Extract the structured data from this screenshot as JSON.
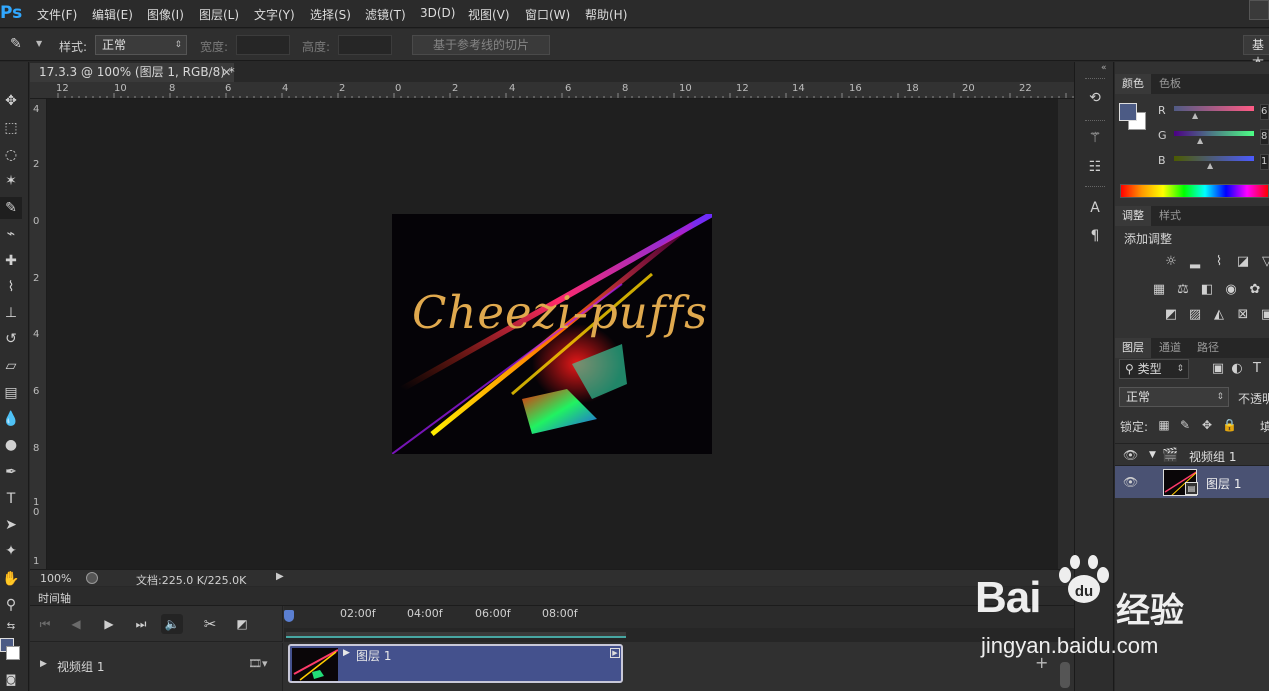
{
  "app": {
    "logo": "Ps"
  },
  "menu": [
    "文件(F)",
    "编辑(E)",
    "图像(I)",
    "图层(L)",
    "文字(Y)",
    "选择(S)",
    "滤镜(T)",
    "3D(D)",
    "视图(V)",
    "窗口(W)",
    "帮助(H)"
  ],
  "options": {
    "style_label": "样式:",
    "style_value": "正常",
    "width_label": "宽度:",
    "height_label": "高度:",
    "guide_slice_button": "基于参考线的切片",
    "workspace": "基本"
  },
  "document": {
    "tab_title": "17.3.3 @ 100% (图层 1, RGB/8) *",
    "artwork_text": "Cheezi-puffs"
  },
  "ruler": {
    "top": [
      "12",
      "10",
      "8",
      "6",
      "4",
      "2",
      "0",
      "2",
      "4",
      "6",
      "8",
      "10",
      "12",
      "14",
      "16",
      "18",
      "20",
      "22"
    ],
    "left": [
      "4",
      "2",
      "0",
      "2",
      "4",
      "6",
      "8",
      "1\n0",
      "1"
    ]
  },
  "status": {
    "zoom": "100%",
    "doc": "文档:225.0 K/225.0K"
  },
  "timeline": {
    "title": "时间轴",
    "times": [
      "02:00f",
      "04:00f",
      "06:00f",
      "08:00f"
    ],
    "track_label": "视频组 1",
    "clip_label": "图层 1"
  },
  "panels": {
    "color_tabs": [
      "颜色",
      "色板"
    ],
    "rgb": [
      {
        "label": "R",
        "value": "6"
      },
      {
        "label": "G",
        "value": "8"
      },
      {
        "label": "B",
        "value": "1"
      }
    ],
    "adjust_tabs": [
      "调整",
      "样式"
    ],
    "adjust_title": "添加调整",
    "layers_tabs": [
      "图层",
      "通道",
      "路径"
    ],
    "filter_label": "类型",
    "blend_mode": "正常",
    "opacity_label": "不透明",
    "lock_label": "锁定:",
    "fill_label": "填",
    "group_name": "视频组 1",
    "layer_name": "图层 1"
  },
  "colors": {
    "foreground": "#4c5b85",
    "background": "#ffffff",
    "accent": "#31a8ff",
    "clip": "#44518d"
  },
  "watermark": {
    "brand": "Bai",
    "brand_cn": "经验",
    "url": "jingyan.baidu.com"
  }
}
